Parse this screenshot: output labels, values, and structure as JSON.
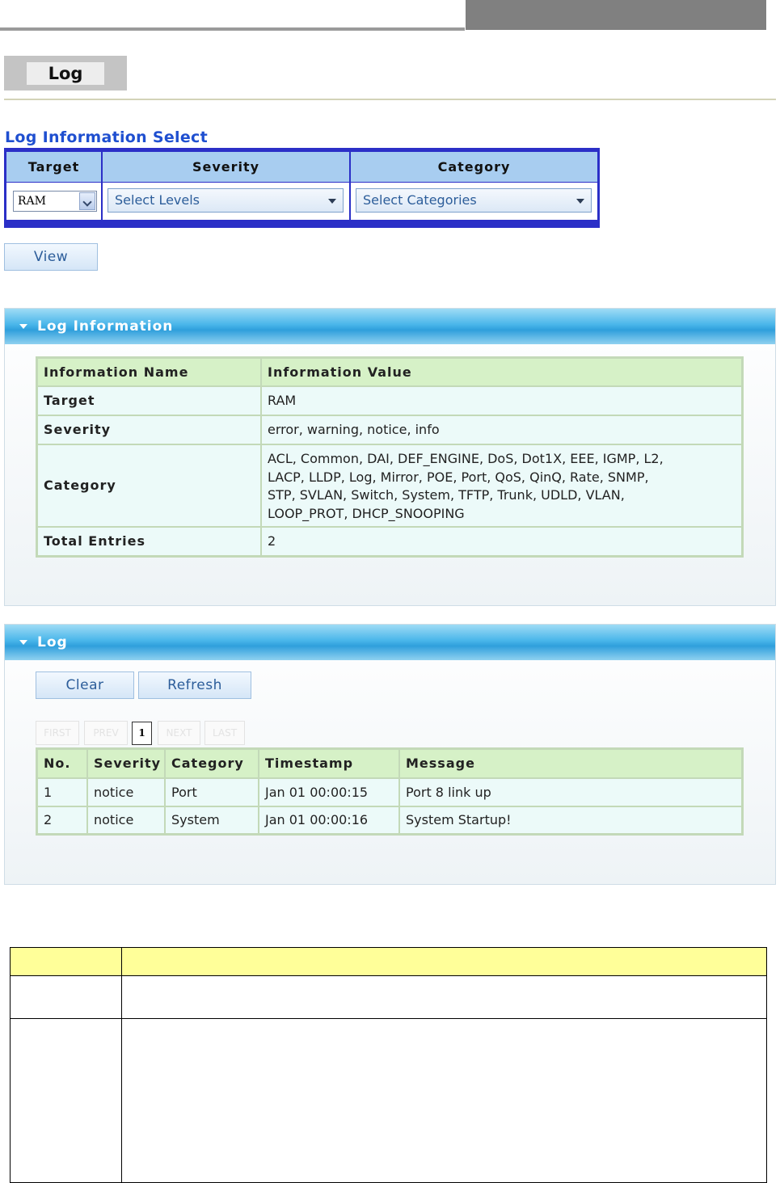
{
  "page": {
    "title": "Log"
  },
  "select": {
    "heading": "Log Information Select",
    "headers": {
      "target": "Target",
      "severity": "Severity",
      "category": "Category"
    },
    "target_value": "RAM",
    "severity_value": "Select Levels",
    "category_value": "Select Categories",
    "view_label": "View"
  },
  "log_info": {
    "panel_title": "Log Information",
    "headers": {
      "name": "Information Name",
      "value": "Information Value"
    },
    "rows": [
      {
        "name": "Target",
        "value": "RAM"
      },
      {
        "name": "Severity",
        "value": "error, warning, notice, info"
      },
      {
        "name": "Category",
        "lines": [
          "ACL, Common, DAI, DEF_ENGINE, DoS, Dot1X, EEE, IGMP, L2,",
          "LACP, LLDP, Log, Mirror, POE, Port, QoS, QinQ, Rate, SNMP,",
          "STP, SVLAN, Switch, System, TFTP, Trunk, UDLD, VLAN,",
          "LOOP_PROT, DHCP_SNOOPING"
        ]
      },
      {
        "name": "Total Entries",
        "value": "2"
      }
    ]
  },
  "log": {
    "panel_title": "Log",
    "clear_label": "Clear",
    "refresh_label": "Refresh",
    "pagination": {
      "first": "FIRST",
      "prev": "PREV",
      "current": "1",
      "next": "NEXT",
      "last": "LAST"
    },
    "headers": {
      "no": "No.",
      "severity": "Severity",
      "category": "Category",
      "timestamp": "Timestamp",
      "message": "Message"
    },
    "rows": [
      {
        "no": "1",
        "severity": "notice",
        "category": "Port",
        "timestamp": "Jan 01 00:00:15",
        "message": "Port 8 link up"
      },
      {
        "no": "2",
        "severity": "notice",
        "category": "System",
        "timestamp": "Jan 01 00:00:16",
        "message": "System Startup!"
      }
    ]
  },
  "colors": {
    "heading_blue": "#1f4fd0",
    "select_border": "#2b2fc7",
    "grid_header": "#d6f1c7",
    "grid_row": "#ecfaf9",
    "doc_header": "#ffff99"
  }
}
